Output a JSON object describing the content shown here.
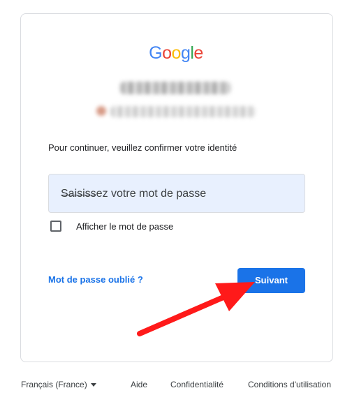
{
  "logo": {
    "letters": [
      "G",
      "o",
      "o",
      "g",
      "l",
      "e"
    ],
    "colors": [
      "#4285F4",
      "#EA4335",
      "#FBBC05",
      "#4285F4",
      "#34A853",
      "#EA4335"
    ]
  },
  "prompt_text": "Pour continuer, veuillez confirmer votre identité",
  "password": {
    "overlay_text": "Saisissez votre mot de passe",
    "value": ""
  },
  "show_password": {
    "label": "Afficher le mot de passe",
    "checked": false
  },
  "forgot_password_label": "Mot de passe oublié ?",
  "next_label": "Suivant",
  "footer": {
    "language": "Français (France)",
    "help": "Aide",
    "privacy": "Confidentialité",
    "terms": "Conditions d'utilisation"
  },
  "colors": {
    "accent": "#1a73e8",
    "field_background": "#e8f0fe",
    "arrow": "#ff1a1a"
  }
}
